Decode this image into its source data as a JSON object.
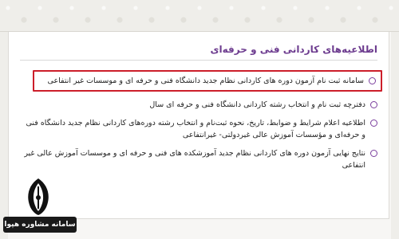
{
  "panel": {
    "title": "اطلاعیه‌های کاردانی فنی و حرفه‌ای"
  },
  "items": [
    {
      "text": "سامانه ثبت نام آزمون دوره های کاردانی نظام جدید دانشگاه فنی و حرفه ای و موسسات غیر انتفاعی",
      "highlighted": true
    },
    {
      "text": "دفترچه ثبت نام و انتخاب رشته کاردانی دانشگاه فنی و حرفه ای سال",
      "highlighted": false
    },
    {
      "text": "اطلاعیه اعلام شرایط و ضوابط، تاریخ، نحوه ثبت‌نام و انتخاب رشته دوره‌های کاردانی نظام جدید دانشگاه فنی و حرفه‌ای و مؤسسات آموزش عالی غیردولتی- غیرانتفاعی",
      "highlighted": false
    },
    {
      "text": "نتایج نهایی آزمون دوره های کاردانی نظام جدید آموزشکده های فنی و حرفه ای و موسسات آموزش عالی غیر انتفاعی",
      "highlighted": false
    }
  ],
  "watermark": {
    "label": "سامانه مشاوره هپوا"
  },
  "colors": {
    "title": "#6d3c8f",
    "bullet": "#7b3f9e",
    "highlight_border": "#cc1e2a"
  }
}
